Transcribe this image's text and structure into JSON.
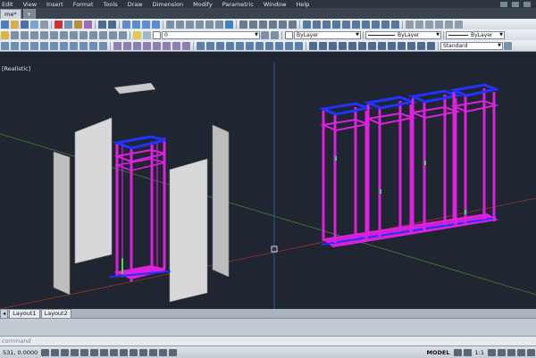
{
  "menubar": {
    "items": [
      "Edit",
      "View",
      "Insert",
      "Format",
      "Tools",
      "Draw",
      "Dimension",
      "Modify",
      "Parametric",
      "Window",
      "Help"
    ]
  },
  "tabs": {
    "file_tab": "me*",
    "new_tab": "+"
  },
  "toolbar2": {
    "layer_value": "0"
  },
  "properties": {
    "color": "ByLayer",
    "linetype": "ByLayer",
    "lineweight": "ByLayer",
    "style": "Standard",
    "scale": "1:1"
  },
  "viewport": {
    "visual_style_label": "[Realistic]"
  },
  "layout_tabs": [
    "Layout1",
    "Layout2"
  ],
  "command": {
    "placeholder": "command"
  },
  "status": {
    "coordinates": "531, 0.0000",
    "space": "MODEL",
    "annotation_scale": "1:1"
  },
  "colors": {
    "viewport_bg": "#1f2631",
    "frame_magenta": "#e020e0",
    "frame_blue": "#2233ff",
    "panel_gray": "#d8d8d8",
    "axis_red": "#a03030",
    "axis_green": "#40803a",
    "axis_blue": "#2a64a8"
  }
}
